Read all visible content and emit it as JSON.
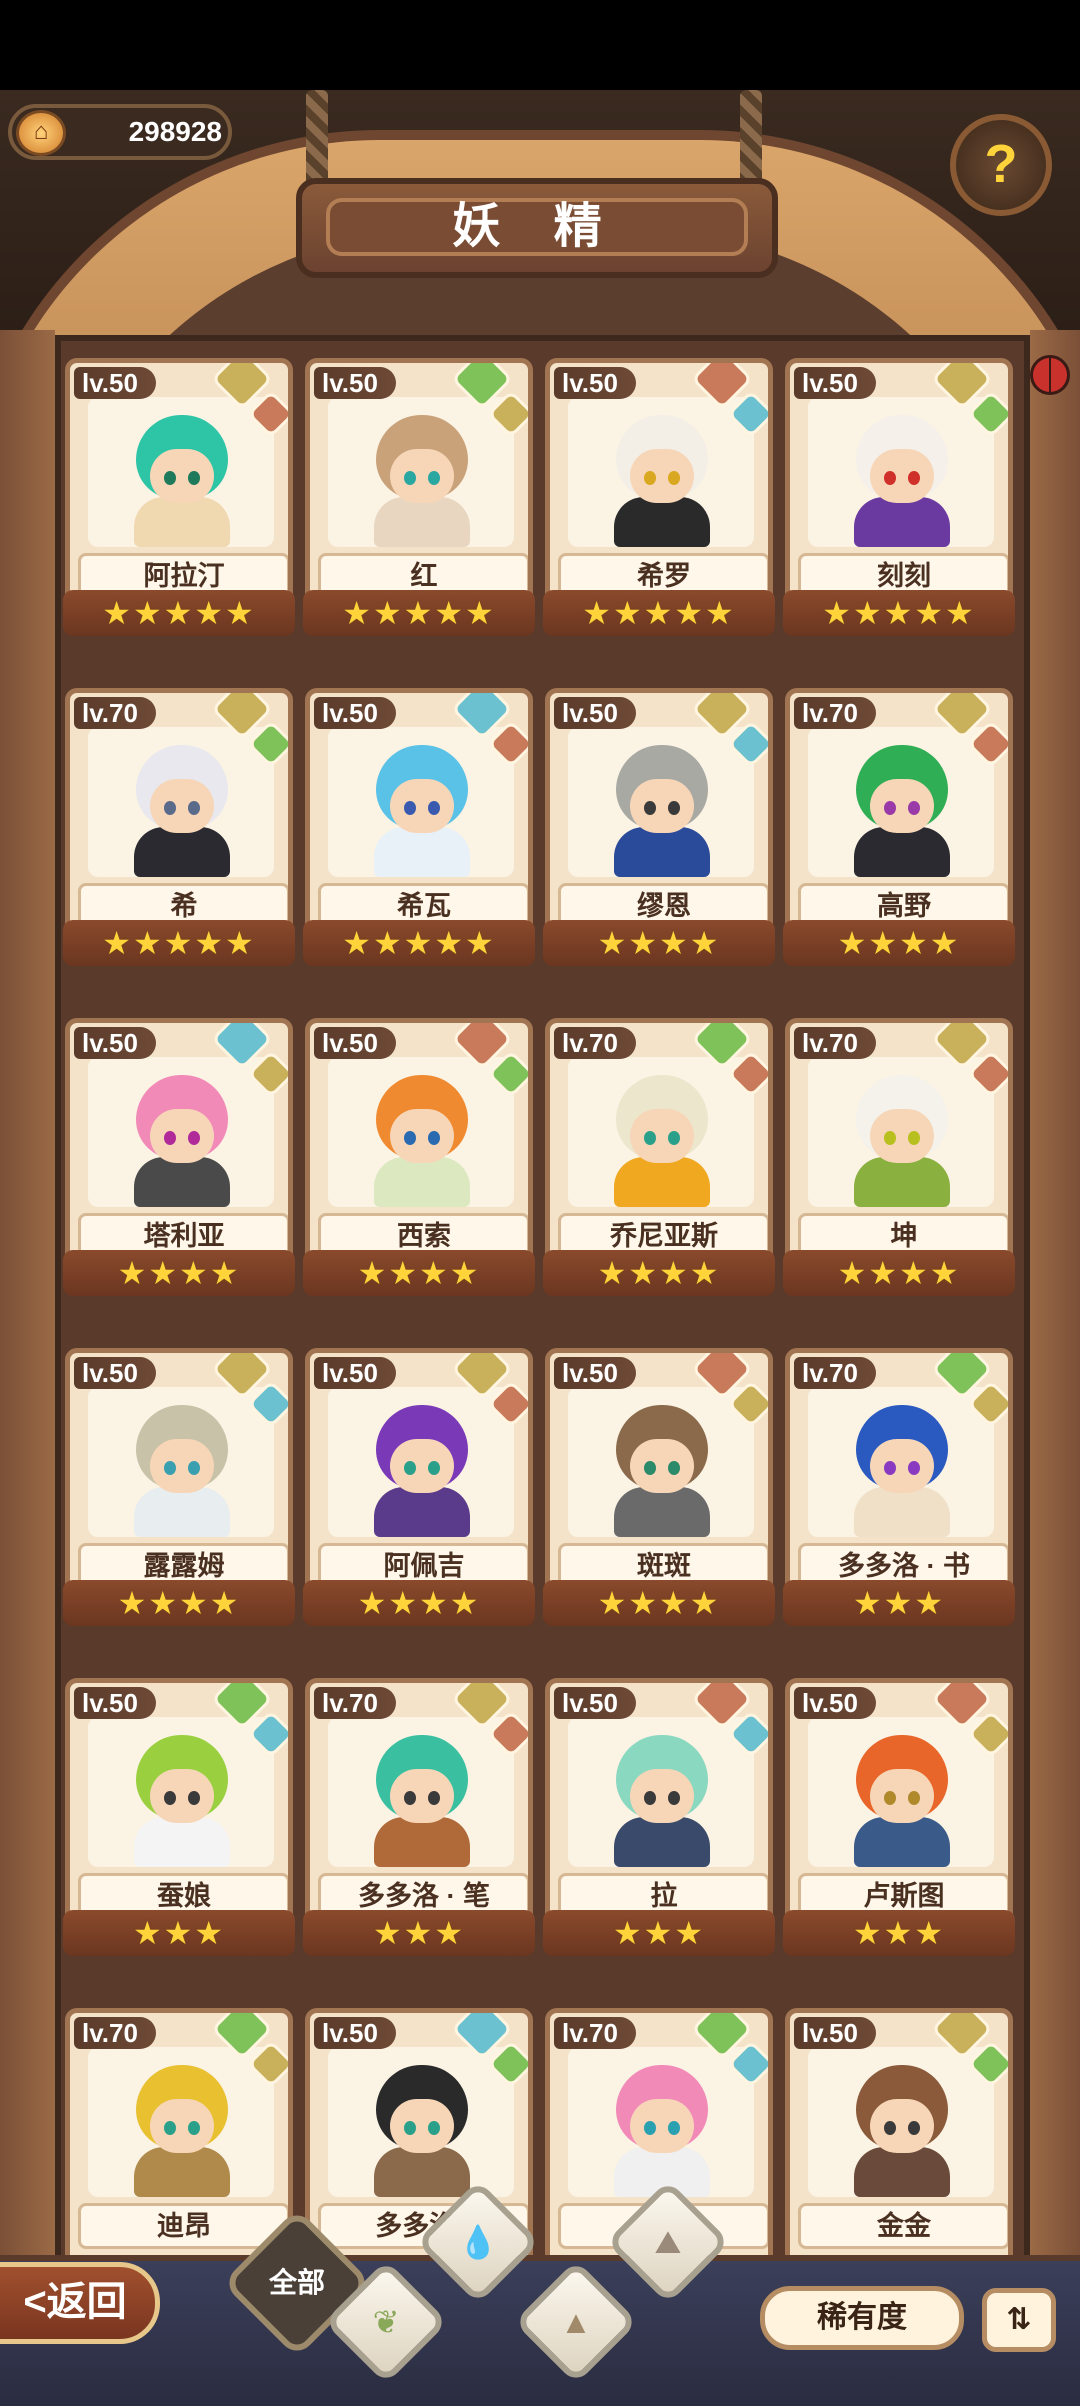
{
  "header": {
    "coins": "298928",
    "title": "妖 精",
    "help_icon": "question-bulb-icon"
  },
  "element_colors": {
    "earth": "#c9b05a",
    "nature": "#7fc25a",
    "water": "#6cc1d0",
    "mountain": "#c97a5a"
  },
  "cards": [
    {
      "level": "lv.50",
      "name": "阿拉汀",
      "stars": "★★★★★",
      "hair": "#2ec4a6",
      "eye": "#1e7a5a",
      "outfit": "#f0d8b0",
      "e1": "earth",
      "e2": "mountain"
    },
    {
      "level": "lv.50",
      "name": "红",
      "stars": "★★★★★",
      "hair": "#c9a27a",
      "eye": "#2aa7a0",
      "outfit": "#e8d6c0",
      "e1": "nature",
      "e2": "earth"
    },
    {
      "level": "lv.50",
      "name": "希罗",
      "stars": "★★★★★",
      "hair": "#f3efe6",
      "eye": "#d9a820",
      "outfit": "#2a2a2a",
      "e1": "mountain",
      "e2": "water"
    },
    {
      "level": "lv.50",
      "name": "刻刻",
      "stars": "★★★★★",
      "hair": "#f5f0ea",
      "eye": "#d0302a",
      "outfit": "#6a3aa0",
      "e1": "earth",
      "e2": "nature"
    },
    {
      "level": "lv.70",
      "name": "希",
      "stars": "★★★★★",
      "hair": "#e8e8ee",
      "eye": "#5a6a8a",
      "outfit": "#2a2a30",
      "e1": "earth",
      "e2": "nature"
    },
    {
      "level": "lv.50",
      "name": "希瓦",
      "stars": "★★★★★",
      "hair": "#5ac2e6",
      "eye": "#3a5ab0",
      "outfit": "#e8f0f8",
      "e1": "water",
      "e2": "mountain"
    },
    {
      "level": "lv.50",
      "name": "缪恩",
      "stars": "★★★★",
      "hair": "#a9a9a4",
      "eye": "#3a3a3a",
      "outfit": "#2a4a9a",
      "e1": "earth",
      "e2": "water"
    },
    {
      "level": "lv.70",
      "name": "高野",
      "stars": "★★★★",
      "hair": "#2fae55",
      "eye": "#9a3aa8",
      "outfit": "#2a2a30",
      "e1": "earth",
      "e2": "mountain"
    },
    {
      "level": "lv.50",
      "name": "塔利亚",
      "stars": "★★★★",
      "hair": "#f28ab8",
      "eye": "#b02a9a",
      "outfit": "#4a4a4a",
      "e1": "water",
      "e2": "earth"
    },
    {
      "level": "lv.50",
      "name": "西索",
      "stars": "★★★★",
      "hair": "#f08a30",
      "eye": "#2a6ab0",
      "outfit": "#dce8c0",
      "e1": "mountain",
      "e2": "nature"
    },
    {
      "level": "lv.70",
      "name": "乔尼亚斯",
      "stars": "★★★★",
      "hair": "#ece6cc",
      "eye": "#2aa08a",
      "outfit": "#f0a820",
      "e1": "nature",
      "e2": "mountain"
    },
    {
      "level": "lv.70",
      "name": "坤",
      "stars": "★★★★",
      "hair": "#f4f2ea",
      "eye": "#b8c020",
      "outfit": "#8ab040",
      "e1": "earth",
      "e2": "mountain"
    },
    {
      "level": "lv.50",
      "name": "露露姆",
      "stars": "★★★★",
      "hair": "#c8c2a8",
      "eye": "#3aa0b0",
      "outfit": "#e8eef0",
      "e1": "earth",
      "e2": "water"
    },
    {
      "level": "lv.50",
      "name": "阿佩吉",
      "stars": "★★★★",
      "hair": "#7a3ab8",
      "eye": "#2aa08a",
      "outfit": "#5a3a8a",
      "e1": "earth",
      "e2": "mountain"
    },
    {
      "level": "lv.50",
      "name": "斑斑",
      "stars": "★★★★",
      "hair": "#8a6a4a",
      "eye": "#2a8a6a",
      "outfit": "#6a6a6a",
      "e1": "mountain",
      "e2": "earth"
    },
    {
      "level": "lv.70",
      "name": "多多洛 · 书",
      "stars": "★★★",
      "hair": "#2a5ac0",
      "eye": "#8a3ac0",
      "outfit": "#f0e0c8",
      "e1": "nature",
      "e2": "earth"
    },
    {
      "level": "lv.50",
      "name": "蚕娘",
      "stars": "★★★",
      "hair": "#9ad040",
      "eye": "#3a3a3a",
      "outfit": "#f4f4f4",
      "e1": "nature",
      "e2": "water"
    },
    {
      "level": "lv.70",
      "name": "多多洛 · 笔",
      "stars": "★★★",
      "hair": "#3ac0a0",
      "eye": "#3a3a3a",
      "outfit": "#b06a3a",
      "e1": "earth",
      "e2": "mountain"
    },
    {
      "level": "lv.50",
      "name": "拉",
      "stars": "★★★",
      "hair": "#8ad8c0",
      "eye": "#3a3a3a",
      "outfit": "#3a4a6a",
      "e1": "mountain",
      "e2": "water"
    },
    {
      "level": "lv.50",
      "name": "卢斯图",
      "stars": "★★★",
      "hair": "#e8662a",
      "eye": "#b08a2a",
      "outfit": "#3a5a8a",
      "e1": "mountain",
      "e2": "earth"
    },
    {
      "level": "lv.70",
      "name": "迪昂",
      "stars": "",
      "hair": "#e8c030",
      "eye": "#2aa08a",
      "outfit": "#b08a4a",
      "e1": "nature",
      "e2": "earth"
    },
    {
      "level": "lv.50",
      "name": "多多洛 · ",
      "stars": "",
      "hair": "#2a2a2a",
      "eye": "#2aa08a",
      "outfit": "#8a6a4a",
      "e1": "water",
      "e2": "nature"
    },
    {
      "level": "lv.70",
      "name": "安",
      "stars": "",
      "hair": "#f28ab8",
      "eye": "#2aa0b0",
      "outfit": "#f0f0f0",
      "e1": "nature",
      "e2": "water"
    },
    {
      "level": "lv.50",
      "name": "金金",
      "stars": "",
      "hair": "#8a5a3a",
      "eye": "#3a3a3a",
      "outfit": "#6a4a3a",
      "e1": "earth",
      "e2": "nature"
    }
  ],
  "footer": {
    "back_label": "<返回",
    "all_label": "全部",
    "filters": [
      "nature-sprout-icon",
      "water-drop-icon",
      "mountain-icon",
      "snow-mountain-icon"
    ],
    "rarity_label": "稀有度",
    "sort_label": "⇅"
  }
}
